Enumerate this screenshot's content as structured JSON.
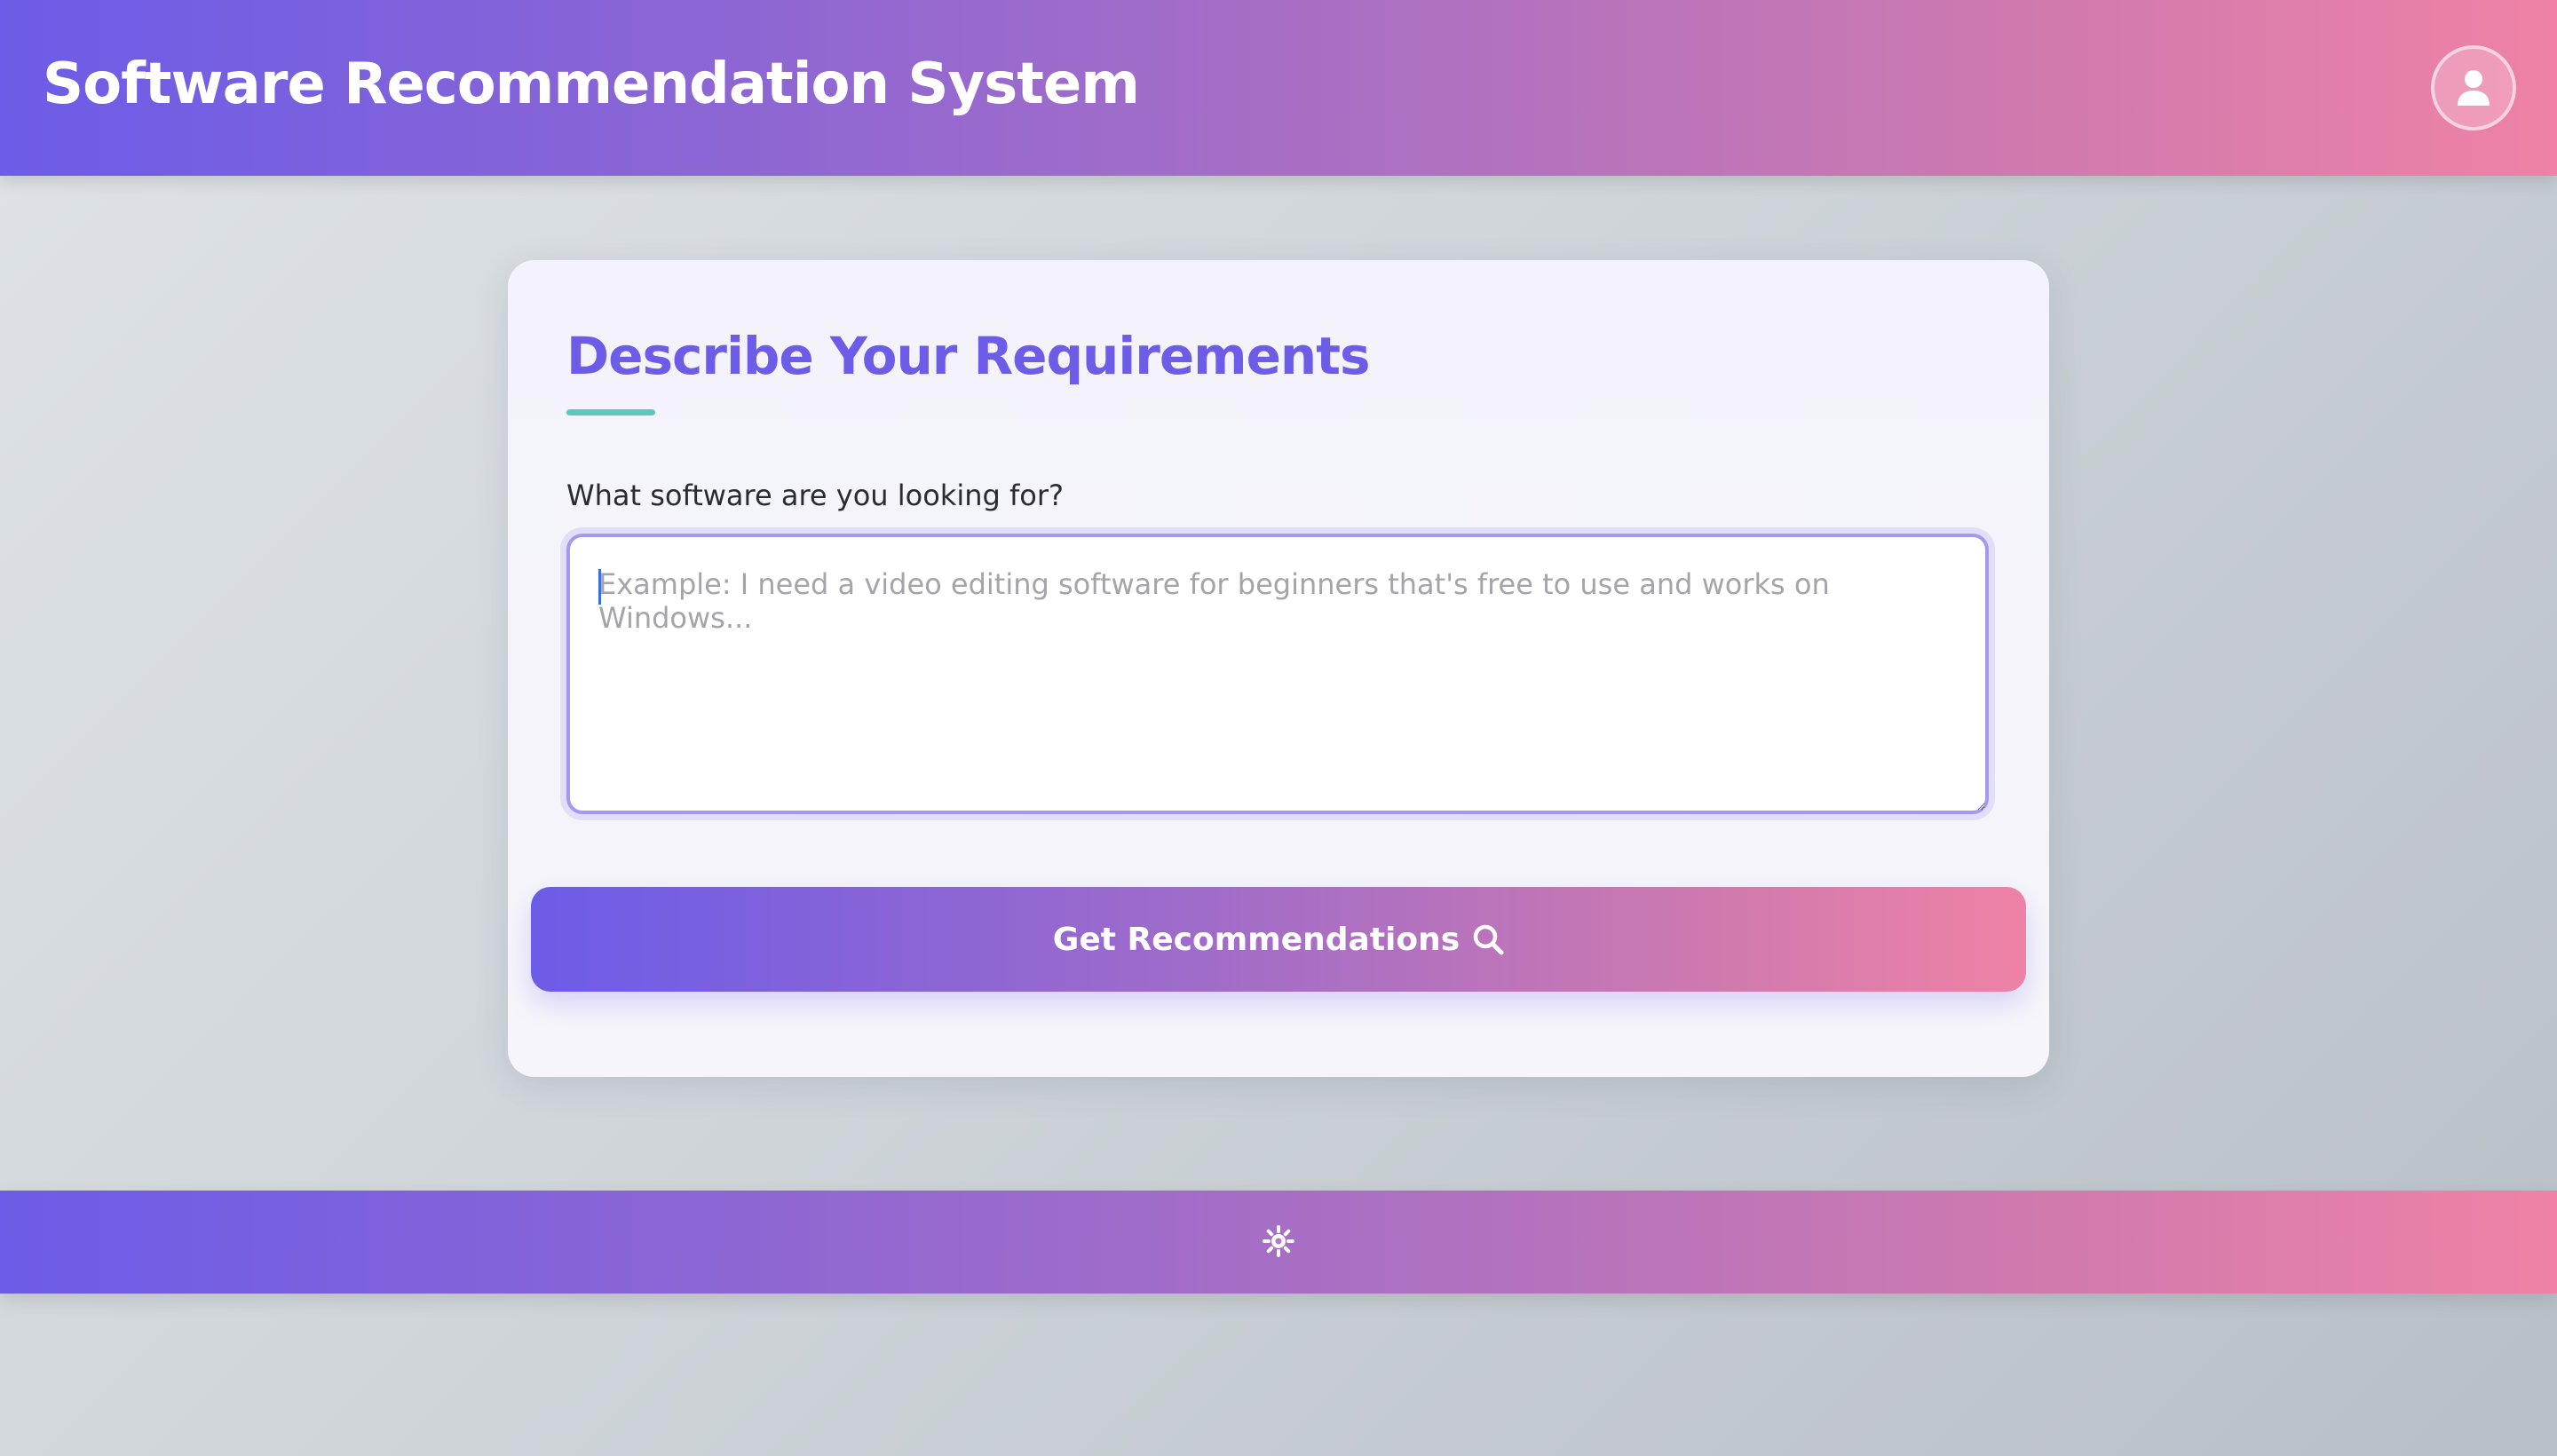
{
  "header": {
    "title": "Software Recommendation System",
    "user_icon": "user-icon"
  },
  "form": {
    "heading": "Describe Your Requirements",
    "field_label": "What software are you looking for?",
    "textarea_value": "",
    "textarea_placeholder": "Example: I need a video editing software for beginners that's free to use and works on Windows...",
    "submit_label": "Get Recommendations",
    "submit_icon": "search-icon"
  },
  "footer": {
    "theme_icon": "sun-icon"
  },
  "colors": {
    "accent": "#6c5ce7",
    "gradient_end": "#ef82a6",
    "underline": "#5cc9c0"
  }
}
